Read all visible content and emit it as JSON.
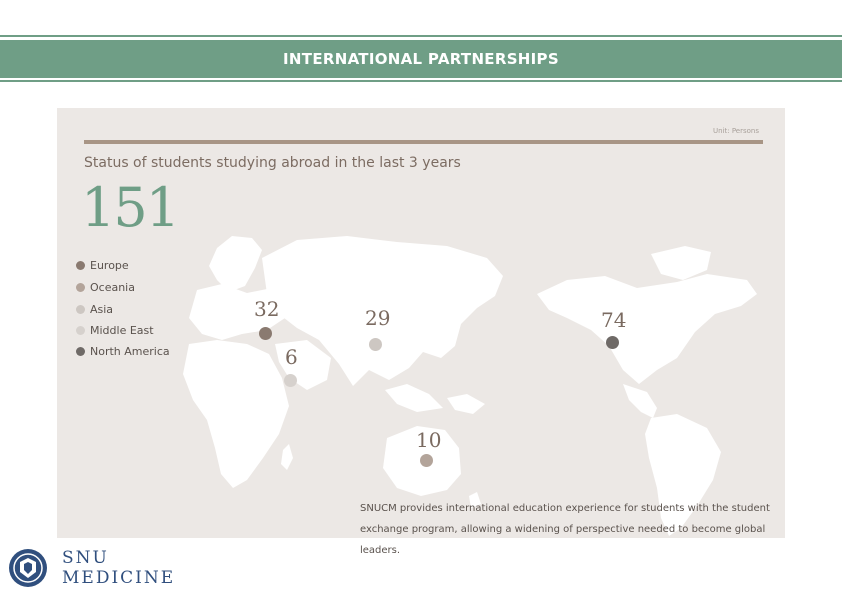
{
  "banner": {
    "title": "INTERNATIONAL PARTNERSHIPS"
  },
  "panel": {
    "unit": "Unit: Persons",
    "subtitle": "Status of students studying abroad in the last 3 years",
    "total": "151",
    "legend": [
      {
        "label": "Europe",
        "color": "#8a7a70"
      },
      {
        "label": "Oceania",
        "color": "#b3a49a"
      },
      {
        "label": "Asia",
        "color": "#cdc7c2"
      },
      {
        "label": "Middle East",
        "color": "#d6d1cd"
      },
      {
        "label": "North America",
        "color": "#6f6a67"
      }
    ],
    "regions": [
      {
        "name": "Europe",
        "value": "32",
        "color": "#8a7a70"
      },
      {
        "name": "Middle East",
        "value": "6",
        "color": "#d6d1cd"
      },
      {
        "name": "Asia",
        "value": "29",
        "color": "#cdc7c2"
      },
      {
        "name": "North America",
        "value": "74",
        "color": "#6f6a67"
      },
      {
        "name": "Oceania",
        "value": "10",
        "color": "#b3a49a"
      }
    ],
    "description": "SNUCM provides international education experience for students with the student exchange program, allowing a widening of perspective needed to become global leaders."
  },
  "logo": {
    "line1": "SNU",
    "line2": "MEDICINE"
  }
}
